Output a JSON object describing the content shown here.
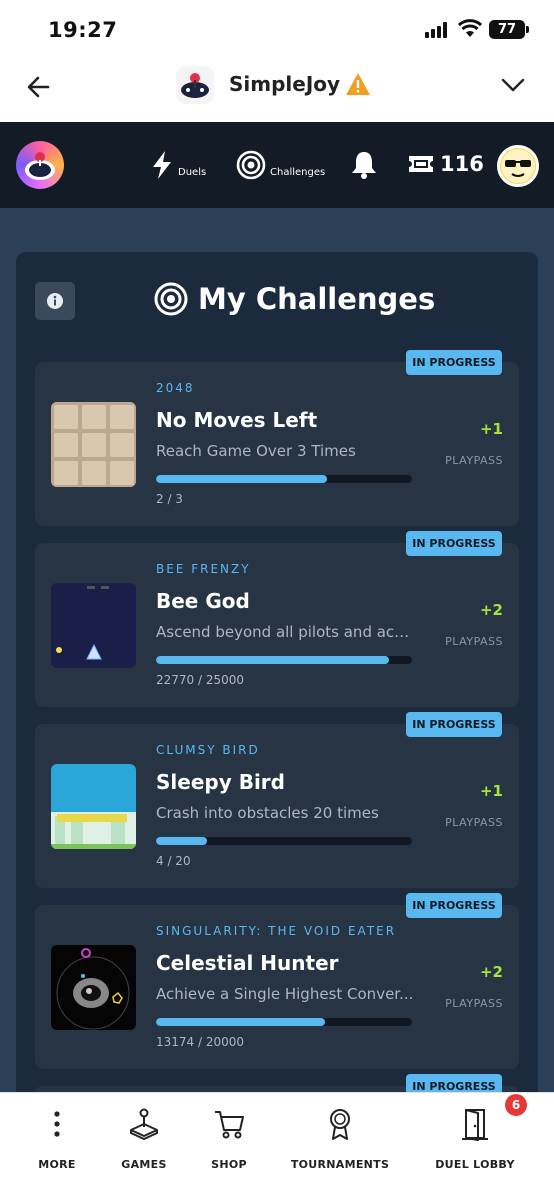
{
  "status_bar": {
    "time": "19:27",
    "battery": "77"
  },
  "app_header": {
    "title": "SimpleJoy"
  },
  "nav": {
    "duels_label": "Duels",
    "challenges_label": "Challenges",
    "tickets": "116"
  },
  "panel": {
    "title": "My Challenges"
  },
  "challenges": [
    {
      "badge": "IN PROGRESS",
      "game": "2048",
      "title": "No Moves Left",
      "description": "Reach Game Over 3 Times",
      "progress_text": "2 / 3",
      "progress": 0.667,
      "reward": "+1",
      "reward_label": "PLAYPASS"
    },
    {
      "badge": "IN PROGRESS",
      "game": "BEE FRENZY",
      "title": "Bee God",
      "description": "Ascend beyond all pilots and achi...",
      "progress_text": "22770 / 25000",
      "progress": 0.911,
      "reward": "+2",
      "reward_label": "PLAYPASS"
    },
    {
      "badge": "IN PROGRESS",
      "game": "CLUMSY BIRD",
      "title": "Sleepy Bird",
      "description": "Crash into obstacles 20 times",
      "progress_text": "4 / 20",
      "progress": 0.2,
      "reward": "+1",
      "reward_label": "PLAYPASS"
    },
    {
      "badge": "IN PROGRESS",
      "game": "SINGULARITY: THE VOID EATER",
      "title": "Celestial Hunter",
      "description": "Achieve a Single Highest Conver...",
      "progress_text": "13174 / 20000",
      "progress": 0.659,
      "reward": "+2",
      "reward_label": "PLAYPASS"
    },
    {
      "badge": "IN PROGRESS"
    }
  ],
  "tabs": [
    {
      "label": "MORE",
      "icon": "more-dots-icon"
    },
    {
      "label": "GAMES",
      "icon": "joystick-icon"
    },
    {
      "label": "SHOP",
      "icon": "cart-icon"
    },
    {
      "label": "TOURNAMENTS",
      "icon": "award-icon"
    },
    {
      "label": "DUEL LOBBY",
      "icon": "door-icon",
      "badge": "6"
    }
  ],
  "colors": {
    "accent": "#5ab8f0",
    "reward": "#a7e33b",
    "nav_bg": "#131b26",
    "page_bg": "#2a4057",
    "card_bg": "#273444"
  }
}
